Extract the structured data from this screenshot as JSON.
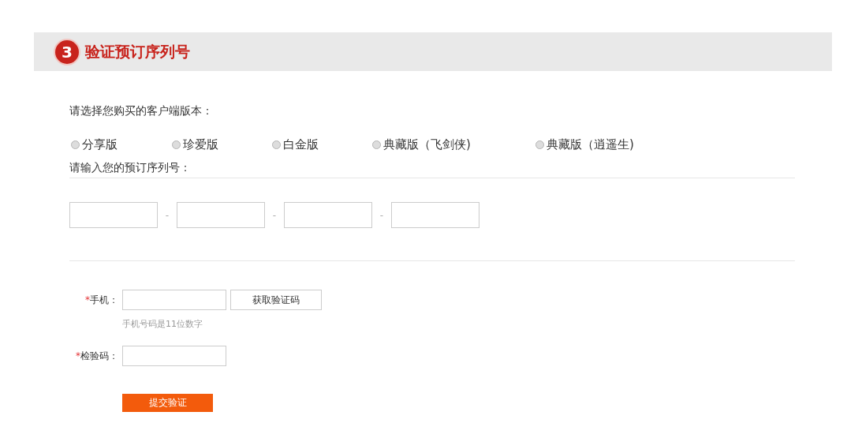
{
  "section": {
    "step": "3",
    "title": "验证预订序列号"
  },
  "edition": {
    "label": "请选择您购买的客户端版本：",
    "options": [
      {
        "label": "分享版",
        "selected": false
      },
      {
        "label": "珍爱版",
        "selected": false
      },
      {
        "label": "白金版",
        "selected": false
      },
      {
        "label": "典藏版（飞剑侠)",
        "selected": false
      },
      {
        "label": "典藏版（逍遥生)",
        "selected": false
      }
    ]
  },
  "serial": {
    "label": "请输入您的预订序列号：",
    "separators": [
      "-",
      "-",
      "-"
    ]
  },
  "phone": {
    "required_mark": "*",
    "label": "手机：",
    "button": "获取验证码",
    "hint": "手机号码是11位数字"
  },
  "code": {
    "required_mark": "*",
    "label": "检验码："
  },
  "submit": "提交验证"
}
